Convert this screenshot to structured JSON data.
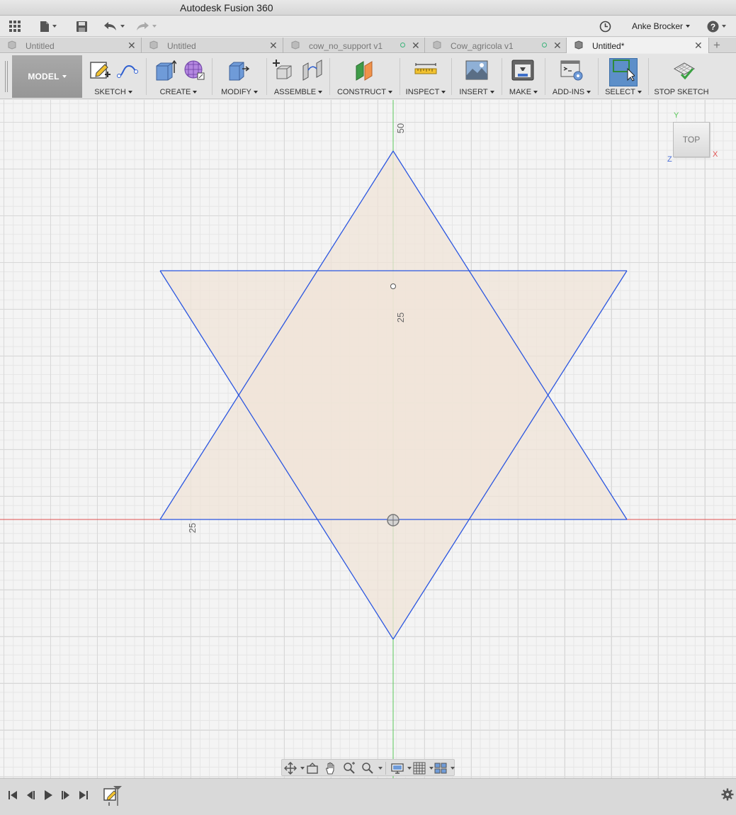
{
  "window": {
    "title": "Autodesk Fusion 360"
  },
  "user": {
    "name": "Anke Brocker"
  },
  "tabs": [
    {
      "label": "Untitled",
      "active": false,
      "saved_indicator": false
    },
    {
      "label": "Untitled",
      "active": false,
      "saved_indicator": false
    },
    {
      "label": "cow_no_support v1",
      "active": false,
      "saved_indicator": true
    },
    {
      "label": "Cow_agricola v1",
      "active": false,
      "saved_indicator": true
    },
    {
      "label": "Untitled*",
      "active": true,
      "saved_indicator": false
    }
  ],
  "ribbon": {
    "workspace": "MODEL",
    "groups": [
      {
        "label": "SKETCH"
      },
      {
        "label": "CREATE"
      },
      {
        "label": "MODIFY"
      },
      {
        "label": "ASSEMBLE"
      },
      {
        "label": "CONSTRUCT"
      },
      {
        "label": "INSPECT"
      },
      {
        "label": "INSERT"
      },
      {
        "label": "MAKE"
      },
      {
        "label": "ADD-INS"
      },
      {
        "label": "SELECT"
      },
      {
        "label": "STOP SKETCH"
      }
    ]
  },
  "canvas": {
    "ruler_labels": {
      "top": "50",
      "mid": "25",
      "left": "25"
    },
    "colors": {
      "profile_fill": "#f0e4d8",
      "sketch_line": "#2b56e0",
      "x_axis": "#e05050",
      "y_axis": "#5ac85a"
    }
  },
  "viewcube": {
    "face": "TOP",
    "x": "X",
    "y": "Y",
    "z": "Z"
  }
}
